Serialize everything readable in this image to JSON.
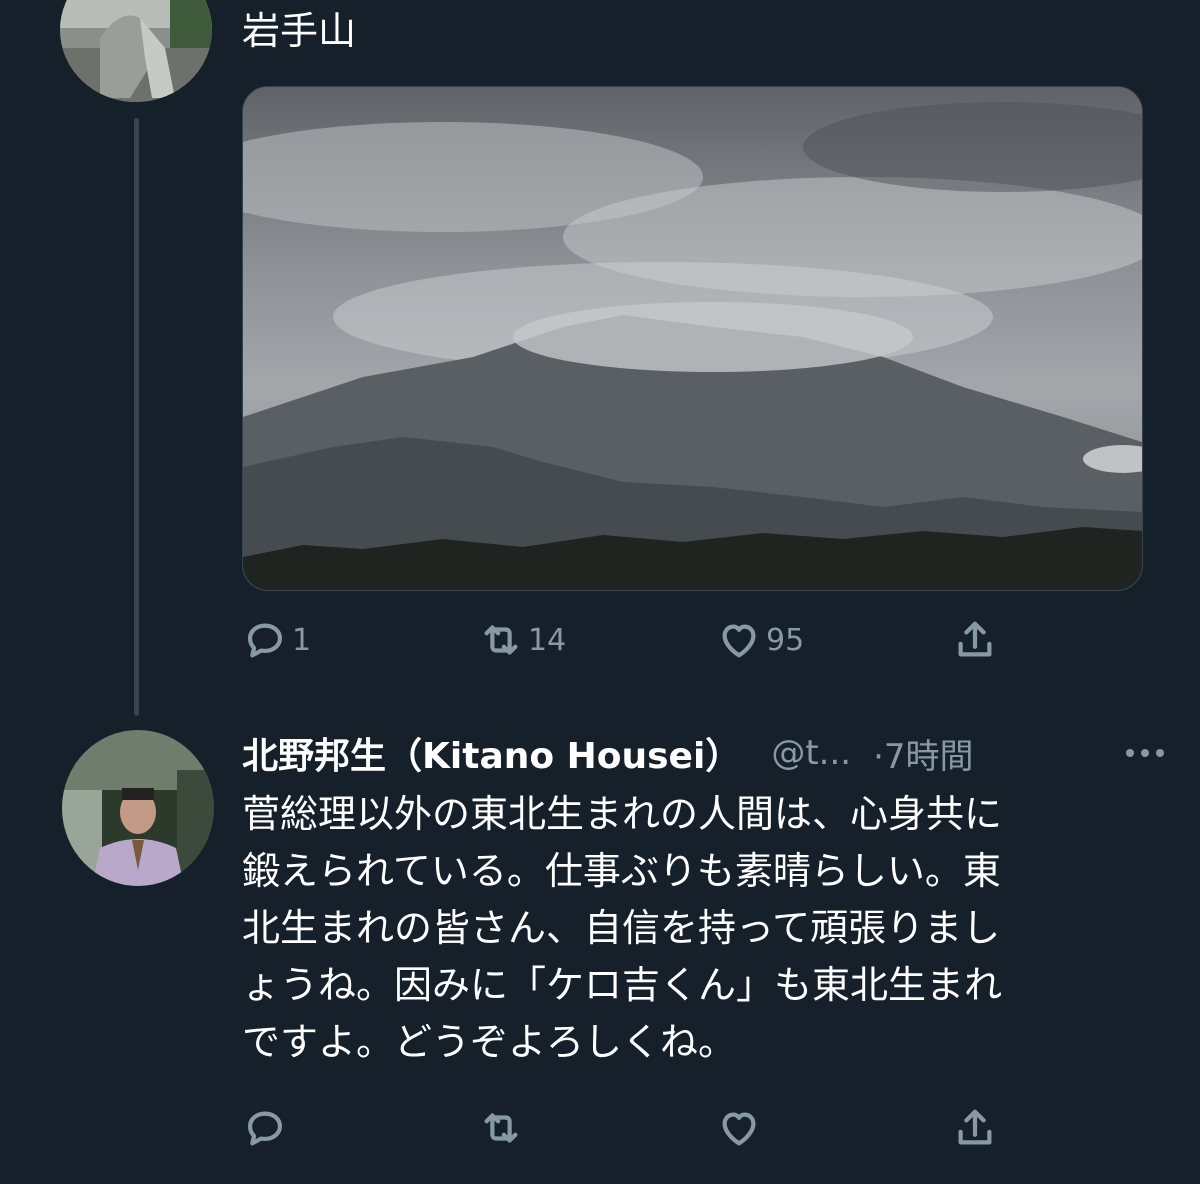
{
  "colors": {
    "background": "#15202b",
    "text": "#ffffff",
    "secondary": "#8899a6",
    "divider": "#38444d"
  },
  "tweet1": {
    "text": "岩手山",
    "media_alt": "",
    "actions": {
      "reply": {
        "icon": "reply-icon",
        "count": "1"
      },
      "retweet": {
        "icon": "retweet-icon",
        "count": "14"
      },
      "like": {
        "icon": "heart-icon",
        "count": "95"
      },
      "share": {
        "icon": "share-icon"
      }
    }
  },
  "tweet2": {
    "name": "北野邦生（Kitano Housei）",
    "handle": "@t...",
    "time": "·7時間",
    "body_lines": [
      "菅総理以外の東北生まれの人間は、心身共に",
      "鍛えられている。仕事ぶりも素晴らしい。東",
      "北生まれの皆さん、自信を持って頑張りまし",
      "ょうね。因みに「ケロ吉くん」も東北生まれ",
      "ですよ。どうぞよろしくね。"
    ],
    "actions": {
      "reply": {
        "icon": "reply-icon"
      },
      "retweet": {
        "icon": "retweet-icon"
      },
      "like": {
        "icon": "heart-icon"
      },
      "share": {
        "icon": "share-icon"
      }
    }
  }
}
